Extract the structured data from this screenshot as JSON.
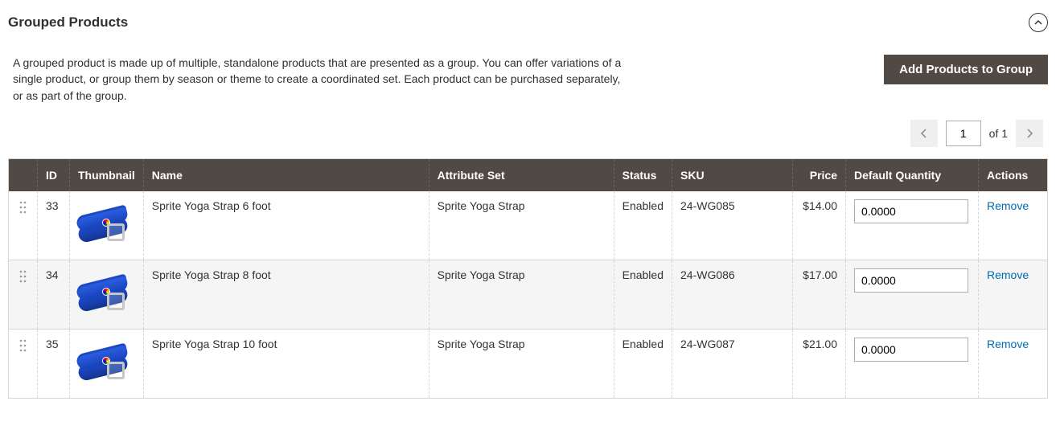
{
  "section": {
    "title": "Grouped Products",
    "description": "A grouped product is made up of multiple, standalone products that are presented as a group. You can offer variations of a single product, or group them by season or theme to create a coordinated set. Each product can be purchased separately, or as part of the group.",
    "add_button_label": "Add Products to Group"
  },
  "pager": {
    "current": "1",
    "of_label": "of 1"
  },
  "columns": {
    "id": "ID",
    "thumbnail": "Thumbnail",
    "name": "Name",
    "attribute_set": "Attribute Set",
    "status": "Status",
    "sku": "SKU",
    "price": "Price",
    "default_qty": "Default Quantity",
    "actions": "Actions"
  },
  "rows": [
    {
      "id": "33",
      "name": "Sprite Yoga Strap 6 foot",
      "attribute_set": "Sprite Yoga Strap",
      "status": "Enabled",
      "sku": "24-WG085",
      "price": "$14.00",
      "qty": "0.0000",
      "action": "Remove"
    },
    {
      "id": "34",
      "name": "Sprite Yoga Strap 8 foot",
      "attribute_set": "Sprite Yoga Strap",
      "status": "Enabled",
      "sku": "24-WG086",
      "price": "$17.00",
      "qty": "0.0000",
      "action": "Remove"
    },
    {
      "id": "35",
      "name": "Sprite Yoga Strap 10 foot",
      "attribute_set": "Sprite Yoga Strap",
      "status": "Enabled",
      "sku": "24-WG087",
      "price": "$21.00",
      "qty": "0.0000",
      "action": "Remove"
    }
  ]
}
